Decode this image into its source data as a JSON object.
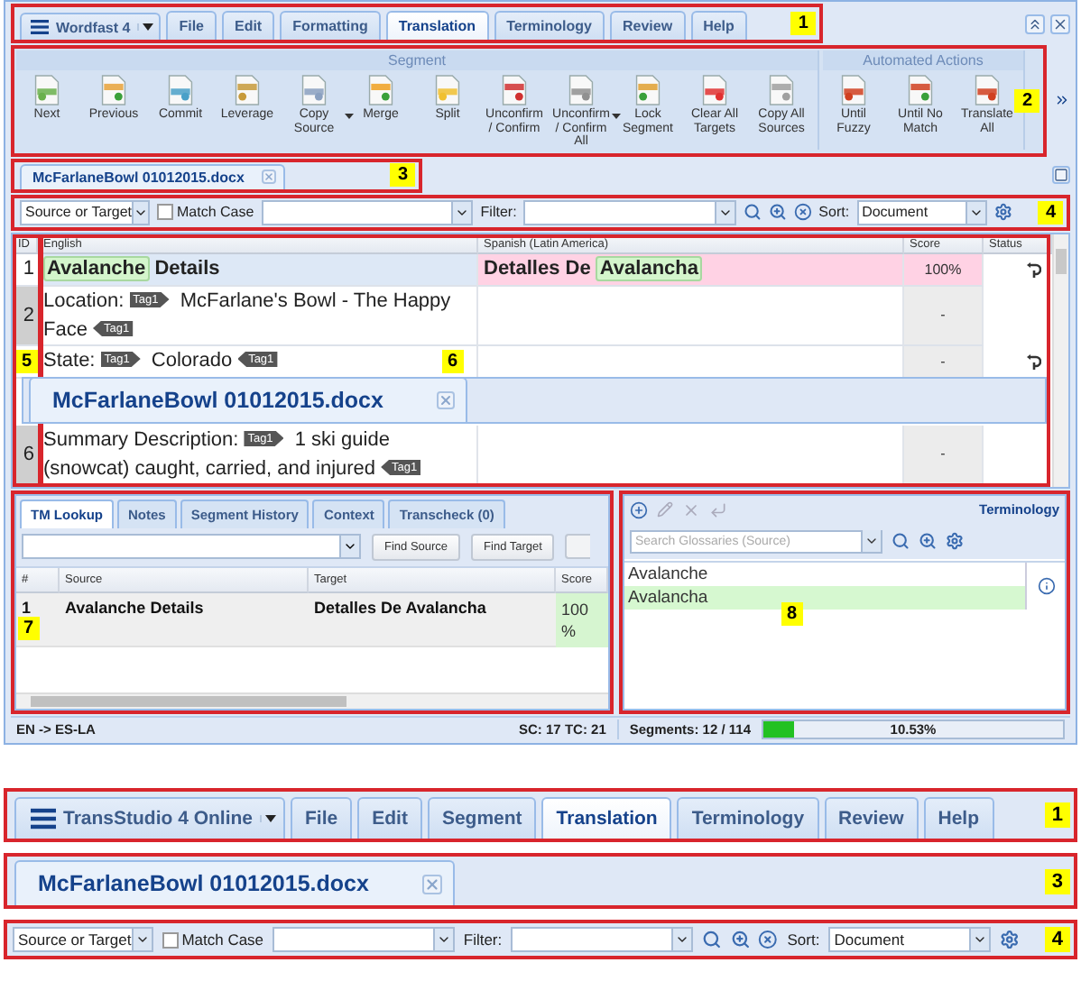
{
  "window": {
    "menu_bar": {
      "callout": "1",
      "app_menu": "Wordfast 4",
      "tabs": [
        {
          "label": "File",
          "selected": false
        },
        {
          "label": "Edit",
          "selected": false
        },
        {
          "label": "Formatting",
          "selected": false
        },
        {
          "label": "Translation",
          "selected": true
        },
        {
          "label": "Terminology",
          "selected": false
        },
        {
          "label": "Review",
          "selected": false
        },
        {
          "label": "Help",
          "selected": false
        }
      ]
    },
    "ribbon": {
      "callout": "2",
      "groups": [
        {
          "title": "Segment",
          "buttons": [
            {
              "label": "Next",
              "dropdown": false
            },
            {
              "label": "Previous",
              "dropdown": false
            },
            {
              "label": "Commit",
              "dropdown": false
            },
            {
              "label": "Leverage",
              "dropdown": false
            },
            {
              "label": "Copy Source",
              "dropdown": true
            },
            {
              "label": "Merge",
              "dropdown": false
            },
            {
              "label": "Split",
              "dropdown": false
            },
            {
              "label": "Unconfirm / Confirm",
              "dropdown": false
            },
            {
              "label": "Unconfirm / Confirm All",
              "dropdown": true
            },
            {
              "label": "Lock Segment",
              "dropdown": false
            },
            {
              "label": "Clear All Targets",
              "dropdown": false
            },
            {
              "label": "Copy All Sources",
              "dropdown": false
            }
          ]
        },
        {
          "title": "Automated Actions",
          "buttons": [
            {
              "label": "Until Fuzzy",
              "dropdown": false
            },
            {
              "label": "Until No Match",
              "dropdown": false
            },
            {
              "label": "Translate All",
              "dropdown": false
            }
          ]
        }
      ]
    },
    "document_tabs": {
      "callout": "3",
      "tabs": [
        {
          "label": "McFarlaneBowl 01012015.docx",
          "selected": true
        }
      ]
    },
    "search_bar": {
      "callout": "4",
      "scope": "Source or Target",
      "match_case": {
        "label": "Match Case",
        "checked": false
      },
      "filter_label": "Filter:",
      "sort_label": "Sort:",
      "sort": "Document"
    },
    "grid": {
      "callouts": [
        "5",
        "6"
      ],
      "columns": [
        "ID",
        "English",
        "Spanish (Latin America)",
        "Score",
        "Status"
      ],
      "rows": [
        {
          "id": "1",
          "selected": true,
          "confirmed": true,
          "score": "100%",
          "source": [
            {
              "kind": "term",
              "text": "Avalanche"
            },
            {
              "kind": "text",
              "text": "Details"
            }
          ],
          "target": [
            {
              "kind": "text",
              "text": "Detalles De"
            },
            {
              "kind": "term",
              "text": "Avalancha"
            }
          ]
        },
        {
          "id": "2",
          "selected": false,
          "confirmed": false,
          "score": "-",
          "source": [
            {
              "kind": "text",
              "text": "Location:"
            },
            {
              "kind": "open_tag",
              "text": "Tag1"
            },
            {
              "kind": "text",
              "text": "McFarlane's Bowl - The Happy Face"
            },
            {
              "kind": "close_tag",
              "text": "Tag1"
            }
          ],
          "target": []
        },
        {
          "selected": false,
          "confirmed": true,
          "score": "-",
          "source": [
            {
              "kind": "text",
              "text": "State:"
            },
            {
              "kind": "open_tag",
              "text": "Tag1"
            },
            {
              "kind": "text",
              "text": "Colorado"
            },
            {
              "kind": "close_tag",
              "text": "Tag1"
            }
          ],
          "target": []
        },
        {
          "id": "6",
          "selected": false,
          "confirmed": false,
          "score": "-",
          "source": [
            {
              "kind": "text",
              "text": "Summary Description:"
            },
            {
              "kind": "open_tag",
              "text": "Tag1"
            },
            {
              "kind": "text",
              "text": "1 ski guide (snowcat) caught, carried, and injured"
            },
            {
              "kind": "close_tag",
              "text": "Tag1"
            }
          ],
          "target": []
        }
      ],
      "zoomed_tab": "McFarlaneBowl 01012015.docx"
    },
    "tm_panel": {
      "callout": "7",
      "tabs": [
        {
          "label": "TM Lookup",
          "selected": true
        },
        {
          "label": "Notes",
          "selected": false
        },
        {
          "label": "Segment History",
          "selected": false
        },
        {
          "label": "Context",
          "selected": false
        },
        {
          "label": "Transcheck (0)",
          "selected": false
        }
      ],
      "buttons": [
        "Find Source",
        "Find Target"
      ],
      "columns": [
        "#",
        "Source",
        "Target",
        "Score"
      ],
      "rows": [
        {
          "number": "1",
          "source": "Avalanche Details",
          "target": "Detalles De Avalancha",
          "score": "100 %"
        }
      ]
    },
    "terminology_panel": {
      "callout": "8",
      "title": "Terminology",
      "search_placeholder": "Search Glossaries (Source)",
      "entries": [
        {
          "source": "Avalanche",
          "target": "Avalancha"
        }
      ]
    },
    "status_bar": {
      "languages": "EN -> ES-LA",
      "counts": "SC: 17 TC: 21",
      "segments": "Segments: 12 / 114",
      "progress": {
        "level": 0.1053,
        "reading": "10.53%"
      }
    }
  },
  "detail_callouts": [
    {
      "kind": "menu_bar",
      "callout": "1",
      "app_menu": "TransStudio 4 Online",
      "tabs": [
        {
          "label": "File",
          "selected": false
        },
        {
          "label": "Edit",
          "selected": false
        },
        {
          "label": "Segment",
          "selected": false
        },
        {
          "label": "Translation",
          "selected": true
        },
        {
          "label": "Terminology",
          "selected": false
        },
        {
          "label": "Review",
          "selected": false
        },
        {
          "label": "Help",
          "selected": false
        }
      ]
    },
    {
      "kind": "document_tabs",
      "callout": "3",
      "tabs": [
        {
          "label": "McFarlaneBowl 01012015.docx",
          "selected": true
        }
      ]
    },
    {
      "kind": "search_bar",
      "callout": "4",
      "scope": "Source or Target",
      "match_case": {
        "label": "Match Case",
        "checked": false
      },
      "filter_label": "Filter:",
      "sort_label": "Sort:",
      "sort": "Document"
    }
  ]
}
